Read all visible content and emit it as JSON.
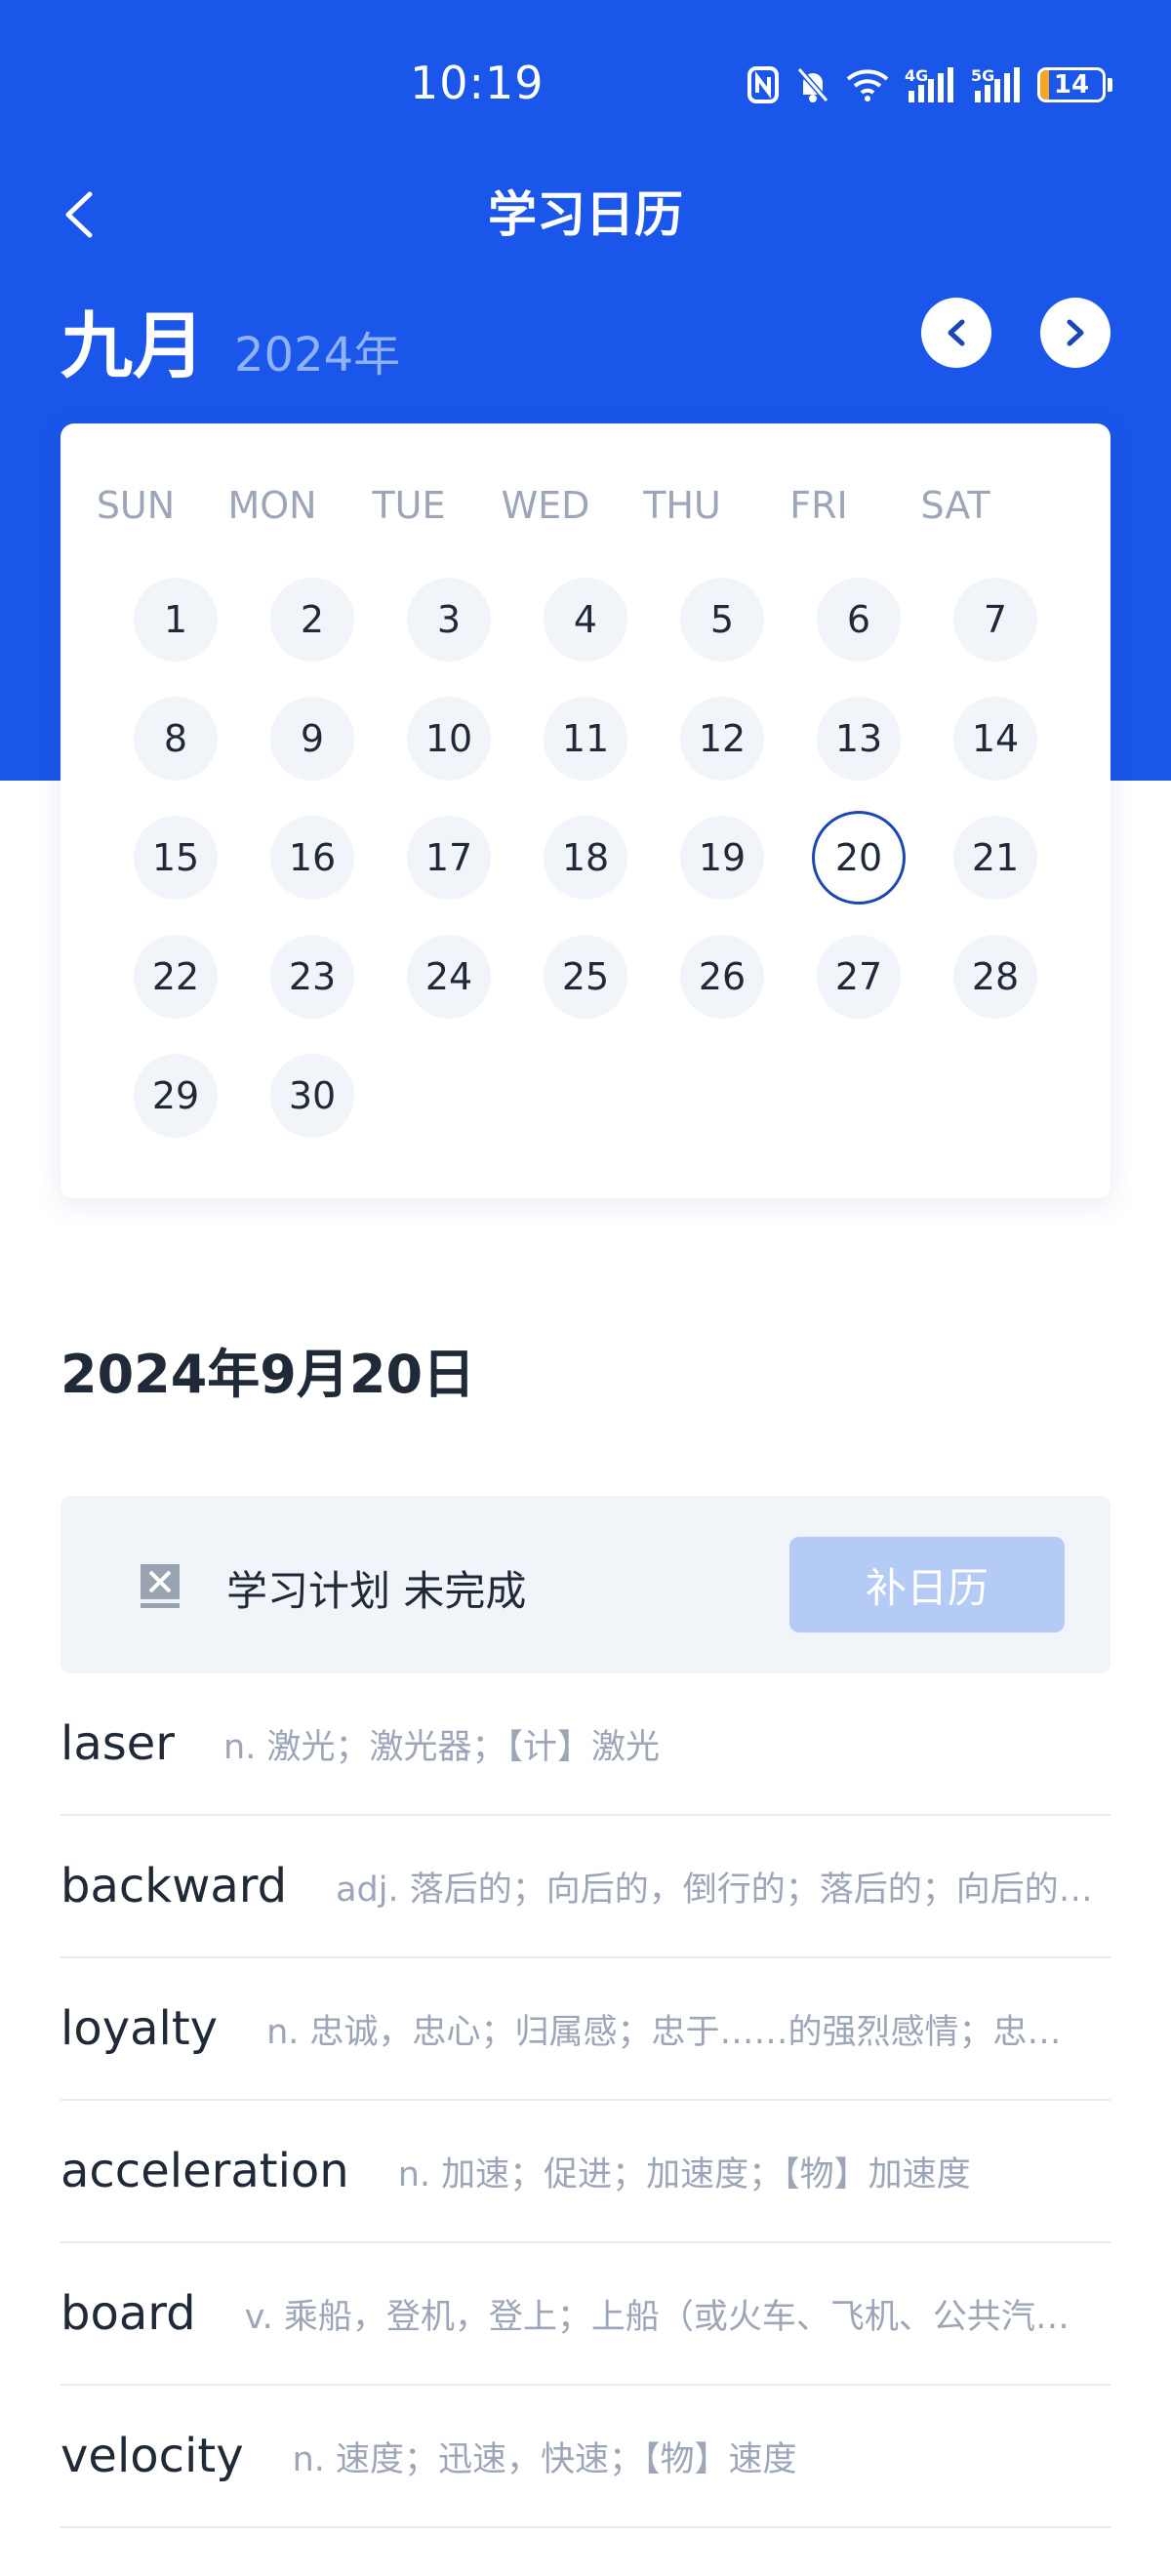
{
  "status_bar": {
    "time": "10:19",
    "battery": "14",
    "battery_level": 0.14,
    "icons": [
      "nfc-icon",
      "mute-bell-icon",
      "wifi-icon",
      "4g-signal-icon",
      "5g-signal-icon",
      "battery-icon"
    ],
    "network_labels": [
      "4G",
      "5G"
    ]
  },
  "nav": {
    "title": "学习日历",
    "back_icon": "chevron-left-icon"
  },
  "calendar": {
    "month": "九月",
    "year": "2024年",
    "prev_icon": "chevron-left-icon",
    "next_icon": "chevron-right-icon",
    "weekdays": [
      "SUN",
      "MON",
      "TUE",
      "WED",
      "THU",
      "FRI",
      "SAT"
    ],
    "first_weekday_index": 0,
    "days": [
      "1",
      "2",
      "3",
      "4",
      "5",
      "6",
      "7",
      "8",
      "9",
      "10",
      "11",
      "12",
      "13",
      "14",
      "15",
      "16",
      "17",
      "18",
      "19",
      "20",
      "21",
      "22",
      "23",
      "24",
      "25",
      "26",
      "27",
      "28",
      "29",
      "30"
    ],
    "selected_day": "20"
  },
  "selected_date": "2024年9月20日",
  "plan": {
    "icon": "incomplete-box-icon",
    "status_text": "学习计划 未完成",
    "button_label": "补日历"
  },
  "words": [
    {
      "term": "laser",
      "definition": "n. 激光；激光器；【计】激光"
    },
    {
      "term": "backward",
      "definition": "adj. 落后的；向后的，倒行的；落后的；向后的…"
    },
    {
      "term": "loyalty",
      "definition": "n. 忠诚，忠心；归属感；忠于……的强烈感情；忠…"
    },
    {
      "term": "acceleration",
      "definition": "n. 加速；促进；加速度；【物】加速度"
    },
    {
      "term": "board",
      "definition": "v. 乘船，登机，登上；上船（或火车、飞机、公共汽…"
    },
    {
      "term": "velocity",
      "definition": "n. 速度；迅速，快速；【物】速度"
    }
  ],
  "colors": {
    "primary": "#1a56ea",
    "selected_ring": "#1a46b8",
    "button_disabled": "#b4cbf6",
    "battery_fill": "#f5a623",
    "muted_text": "#9ca6b8"
  }
}
